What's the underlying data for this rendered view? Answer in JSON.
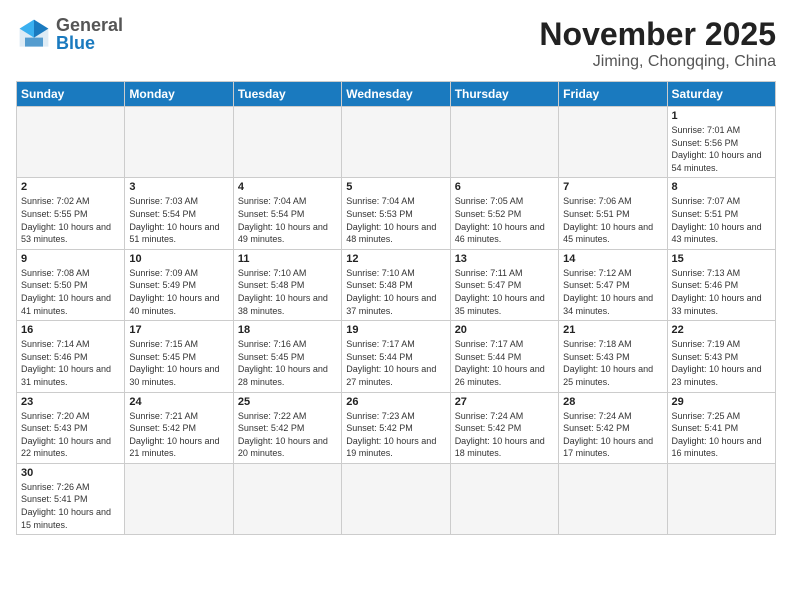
{
  "header": {
    "logo_general": "General",
    "logo_blue": "Blue",
    "month_title": "November 2025",
    "location": "Jiming, Chongqing, China"
  },
  "weekdays": [
    "Sunday",
    "Monday",
    "Tuesday",
    "Wednesday",
    "Thursday",
    "Friday",
    "Saturday"
  ],
  "weeks": [
    [
      {
        "day": "",
        "info": ""
      },
      {
        "day": "",
        "info": ""
      },
      {
        "day": "",
        "info": ""
      },
      {
        "day": "",
        "info": ""
      },
      {
        "day": "",
        "info": ""
      },
      {
        "day": "",
        "info": ""
      },
      {
        "day": "1",
        "info": "Sunrise: 7:01 AM\nSunset: 5:56 PM\nDaylight: 10 hours\nand 54 minutes."
      }
    ],
    [
      {
        "day": "2",
        "info": "Sunrise: 7:02 AM\nSunset: 5:55 PM\nDaylight: 10 hours\nand 53 minutes."
      },
      {
        "day": "3",
        "info": "Sunrise: 7:03 AM\nSunset: 5:54 PM\nDaylight: 10 hours\nand 51 minutes."
      },
      {
        "day": "4",
        "info": "Sunrise: 7:04 AM\nSunset: 5:54 PM\nDaylight: 10 hours\nand 49 minutes."
      },
      {
        "day": "5",
        "info": "Sunrise: 7:04 AM\nSunset: 5:53 PM\nDaylight: 10 hours\nand 48 minutes."
      },
      {
        "day": "6",
        "info": "Sunrise: 7:05 AM\nSunset: 5:52 PM\nDaylight: 10 hours\nand 46 minutes."
      },
      {
        "day": "7",
        "info": "Sunrise: 7:06 AM\nSunset: 5:51 PM\nDaylight: 10 hours\nand 45 minutes."
      },
      {
        "day": "8",
        "info": "Sunrise: 7:07 AM\nSunset: 5:51 PM\nDaylight: 10 hours\nand 43 minutes."
      }
    ],
    [
      {
        "day": "9",
        "info": "Sunrise: 7:08 AM\nSunset: 5:50 PM\nDaylight: 10 hours\nand 41 minutes."
      },
      {
        "day": "10",
        "info": "Sunrise: 7:09 AM\nSunset: 5:49 PM\nDaylight: 10 hours\nand 40 minutes."
      },
      {
        "day": "11",
        "info": "Sunrise: 7:10 AM\nSunset: 5:48 PM\nDaylight: 10 hours\nand 38 minutes."
      },
      {
        "day": "12",
        "info": "Sunrise: 7:10 AM\nSunset: 5:48 PM\nDaylight: 10 hours\nand 37 minutes."
      },
      {
        "day": "13",
        "info": "Sunrise: 7:11 AM\nSunset: 5:47 PM\nDaylight: 10 hours\nand 35 minutes."
      },
      {
        "day": "14",
        "info": "Sunrise: 7:12 AM\nSunset: 5:47 PM\nDaylight: 10 hours\nand 34 minutes."
      },
      {
        "day": "15",
        "info": "Sunrise: 7:13 AM\nSunset: 5:46 PM\nDaylight: 10 hours\nand 33 minutes."
      }
    ],
    [
      {
        "day": "16",
        "info": "Sunrise: 7:14 AM\nSunset: 5:46 PM\nDaylight: 10 hours\nand 31 minutes."
      },
      {
        "day": "17",
        "info": "Sunrise: 7:15 AM\nSunset: 5:45 PM\nDaylight: 10 hours\nand 30 minutes."
      },
      {
        "day": "18",
        "info": "Sunrise: 7:16 AM\nSunset: 5:45 PM\nDaylight: 10 hours\nand 28 minutes."
      },
      {
        "day": "19",
        "info": "Sunrise: 7:17 AM\nSunset: 5:44 PM\nDaylight: 10 hours\nand 27 minutes."
      },
      {
        "day": "20",
        "info": "Sunrise: 7:17 AM\nSunset: 5:44 PM\nDaylight: 10 hours\nand 26 minutes."
      },
      {
        "day": "21",
        "info": "Sunrise: 7:18 AM\nSunset: 5:43 PM\nDaylight: 10 hours\nand 25 minutes."
      },
      {
        "day": "22",
        "info": "Sunrise: 7:19 AM\nSunset: 5:43 PM\nDaylight: 10 hours\nand 23 minutes."
      }
    ],
    [
      {
        "day": "23",
        "info": "Sunrise: 7:20 AM\nSunset: 5:43 PM\nDaylight: 10 hours\nand 22 minutes."
      },
      {
        "day": "24",
        "info": "Sunrise: 7:21 AM\nSunset: 5:42 PM\nDaylight: 10 hours\nand 21 minutes."
      },
      {
        "day": "25",
        "info": "Sunrise: 7:22 AM\nSunset: 5:42 PM\nDaylight: 10 hours\nand 20 minutes."
      },
      {
        "day": "26",
        "info": "Sunrise: 7:23 AM\nSunset: 5:42 PM\nDaylight: 10 hours\nand 19 minutes."
      },
      {
        "day": "27",
        "info": "Sunrise: 7:24 AM\nSunset: 5:42 PM\nDaylight: 10 hours\nand 18 minutes."
      },
      {
        "day": "28",
        "info": "Sunrise: 7:24 AM\nSunset: 5:42 PM\nDaylight: 10 hours\nand 17 minutes."
      },
      {
        "day": "29",
        "info": "Sunrise: 7:25 AM\nSunset: 5:41 PM\nDaylight: 10 hours\nand 16 minutes."
      }
    ],
    [
      {
        "day": "30",
        "info": "Sunrise: 7:26 AM\nSunset: 5:41 PM\nDaylight: 10 hours\nand 15 minutes."
      },
      {
        "day": "",
        "info": ""
      },
      {
        "day": "",
        "info": ""
      },
      {
        "day": "",
        "info": ""
      },
      {
        "day": "",
        "info": ""
      },
      {
        "day": "",
        "info": ""
      },
      {
        "day": "",
        "info": ""
      }
    ]
  ]
}
